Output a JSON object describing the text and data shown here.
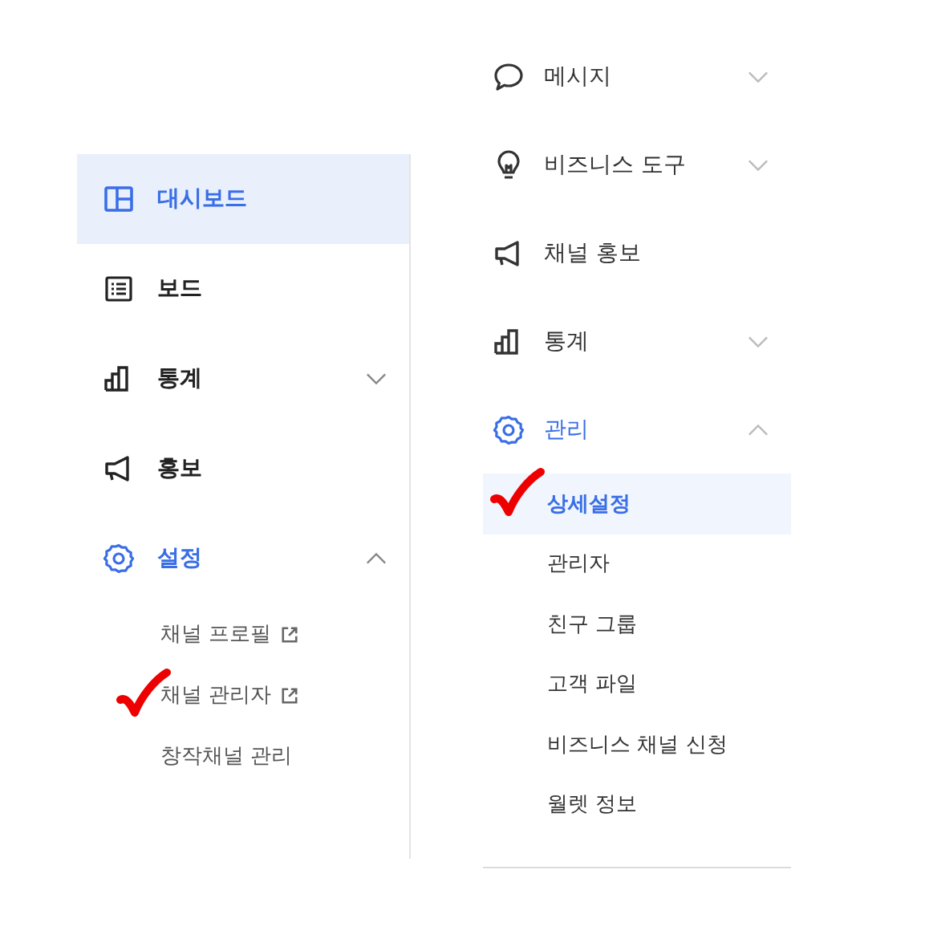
{
  "left_menu": {
    "items": [
      {
        "label": "대시보드",
        "selected": true
      },
      {
        "label": "보드",
        "selected": false
      },
      {
        "label": "통계",
        "selected": false,
        "expanded": false
      },
      {
        "label": "홍보",
        "selected": false
      },
      {
        "label": "설정",
        "selected": false,
        "expanded": true,
        "children": [
          {
            "label": "채널 프로필",
            "selected": false,
            "external_link": true,
            "marked": false
          },
          {
            "label": "채널 관리자",
            "selected": false,
            "external_link": true,
            "marked": true
          },
          {
            "label": "창작채널 관리",
            "selected": false,
            "external_link": false,
            "marked": false
          }
        ]
      }
    ]
  },
  "right_menu": {
    "items": [
      {
        "label": "메시지",
        "selected": false,
        "expanded": false
      },
      {
        "label": "비즈니스 도구",
        "selected": false,
        "expanded": false
      },
      {
        "label": "채널 홍보",
        "selected": false
      },
      {
        "label": "통계",
        "selected": false,
        "expanded": false
      },
      {
        "label": "관리",
        "selected": false,
        "expanded": true,
        "children": [
          {
            "label": "상세설정",
            "selected": true,
            "external_link": false,
            "marked": true
          },
          {
            "label": "관리자",
            "selected": false,
            "external_link": false,
            "marked": false
          },
          {
            "label": "친구 그룹",
            "selected": false,
            "external_link": false,
            "marked": false
          },
          {
            "label": "고객 파일",
            "selected": false,
            "external_link": false,
            "marked": false
          },
          {
            "label": "비즈니스 채널 신청",
            "selected": false,
            "external_link": false,
            "marked": false
          },
          {
            "label": "월렛 정보",
            "selected": false,
            "external_link": false,
            "marked": false
          }
        ]
      }
    ]
  }
}
